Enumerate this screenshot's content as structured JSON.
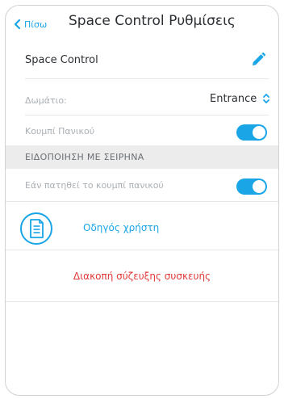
{
  "header": {
    "back_label": "Πίσω",
    "title": "Space Control Ρυθμίσεις"
  },
  "device": {
    "name": "Space Control",
    "edit_icon": "pencil-icon"
  },
  "room": {
    "label": "Δωμάτιο:",
    "value": "Entrance"
  },
  "panic_button": {
    "label": "Κουμπί Πανικού",
    "enabled": true
  },
  "siren_section": {
    "header": "ΕΙΔΟΠΟΙΗΣΗ ΜΕ ΣΕΙΡΗΝΑ",
    "option_label": "Εάν πατηθεί το κουμπί πανικού",
    "enabled": true
  },
  "guide": {
    "label": "Οδηγός χρήστη",
    "icon": "document-icon"
  },
  "disconnect": {
    "label": "Διακοπή σύζευξης συσκευής"
  },
  "colors": {
    "accent": "#1aa5e6",
    "danger": "#e23a3a",
    "section_bg": "#ececec"
  }
}
